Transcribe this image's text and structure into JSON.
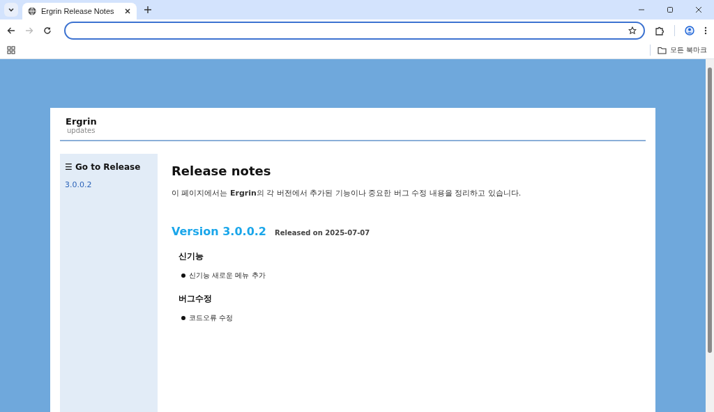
{
  "browser": {
    "tab_title": "Ergrin Release Notes",
    "bookmarks_folder": "모든 북마크"
  },
  "site": {
    "title": "Ergrin",
    "subtitle": "updates"
  },
  "sidebar": {
    "heading": "☰ Go to Release",
    "items": [
      "3.0.0.2"
    ]
  },
  "main": {
    "title": "Release notes",
    "intro": "이 페이지에서는 **Ergrin**의 각 버전에서 추가된 기능이나 중요한 버그 수정 내용을 정리하고 있습니다.",
    "versions": [
      {
        "version": "Version 3.0.0.2",
        "released": "Released on 2025-07-07",
        "sections": [
          {
            "heading": "신기능",
            "items": [
              "신기능 새로운 메뉴 추가"
            ]
          },
          {
            "heading": "버그수정",
            "items": [
              "코드오류 수정"
            ]
          }
        ]
      }
    ]
  }
}
